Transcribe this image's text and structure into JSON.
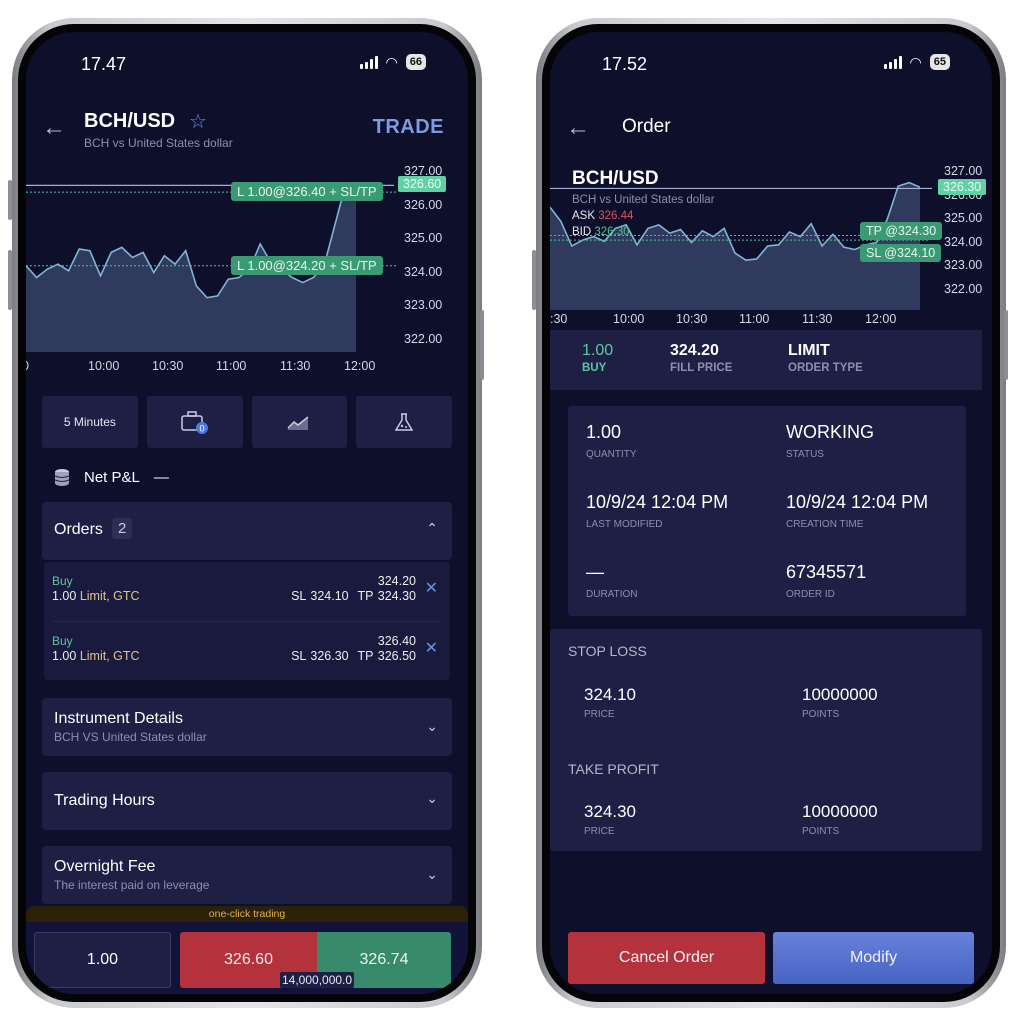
{
  "left": {
    "status": {
      "time": "17.47",
      "battery": "66"
    },
    "header": {
      "title": "BCH/USD",
      "subtitle": "BCH vs United States dollar",
      "trade_label": "TRADE"
    },
    "chart": {
      "y_ticks": [
        "327.00",
        "326.00",
        "325.00",
        "324.00",
        "323.00",
        "322.00"
      ],
      "x_ticks": [
        "0",
        "10:00",
        "10:30",
        "11:00",
        "11:30",
        "12:00"
      ],
      "current_price": "326.60",
      "order_lines": [
        {
          "label": "L 1.00@326.40 + SL/TP",
          "price": 326.4
        },
        {
          "label": "L 1.00@324.20 + SL/TP",
          "price": 324.2
        }
      ]
    },
    "tools": {
      "timeframe": "5 Minutes",
      "portfolio_badge": "0"
    },
    "net_pnl": {
      "label": "Net P&L",
      "value": "—"
    },
    "orders": {
      "title": "Orders",
      "count": "2",
      "items": [
        {
          "side": "Buy",
          "qty": "1.00",
          "type": "Limit, GTC",
          "price": "324.20",
          "sl": "SL 324.10",
          "tp": "TP 324.30"
        },
        {
          "side": "Buy",
          "qty": "1.00",
          "type": "Limit, GTC",
          "price": "326.40",
          "sl": "SL 326.30",
          "tp": "TP 326.50"
        }
      ]
    },
    "sections": [
      {
        "title": "Instrument Details",
        "subtitle": "BCH VS United States dollar"
      },
      {
        "title": "Trading Hours",
        "subtitle": ""
      },
      {
        "title": "Overnight Fee",
        "subtitle": "The interest paid on leverage"
      }
    ],
    "one_click": "one-click trading",
    "trade_bar": {
      "quantity": "1.00",
      "sell_price": "326.60",
      "buy_price": "326.74",
      "volume": "14,000,000.0"
    }
  },
  "right": {
    "status": {
      "time": "17.52",
      "battery": "65"
    },
    "header": {
      "title": "Order"
    },
    "chart": {
      "symbol": "BCH/USD",
      "subtitle": "BCH vs United States dollar",
      "ask_label": "ASK",
      "ask": "326.44",
      "bid_label": "BID",
      "bid": "326.30",
      "y_ticks": [
        "327.00",
        "326.00",
        "325.00",
        "324.00",
        "323.00",
        "322.00"
      ],
      "x_ticks": ":30",
      "x_ticks_list": [
        ":30",
        "10:00",
        "10:30",
        "11:00",
        "11:30",
        "12:00"
      ],
      "current_price": "326.30",
      "tp_label": "TP @324.30",
      "sl_label": "SL @324.10"
    },
    "summary": [
      {
        "value": "1.00",
        "label": "BUY"
      },
      {
        "value": "324.20",
        "label": "FILL PRICE"
      },
      {
        "value": "LIMIT",
        "label": "ORDER TYPE"
      }
    ],
    "details": [
      {
        "value": "1.00",
        "label": "QUANTITY"
      },
      {
        "value": "WORKING",
        "label": "STATUS"
      },
      {
        "value": "10/9/24 12:04 PM",
        "label": "LAST MODIFIED"
      },
      {
        "value": "10/9/24 12:04 PM",
        "label": "CREATION TIME"
      },
      {
        "value": "—",
        "label": "DURATION"
      },
      {
        "value": "67345571",
        "label": "ORDER ID"
      }
    ],
    "stop_loss": {
      "title": "STOP LOSS",
      "price": "324.10",
      "price_label": "PRICE",
      "points": "10000000",
      "points_label": "POINTS"
    },
    "take_profit": {
      "title": "TAKE PROFIT",
      "price": "324.30",
      "price_label": "PRICE",
      "points": "10000000",
      "points_label": "POINTS"
    },
    "buttons": {
      "cancel": "Cancel Order",
      "modify": "Modify"
    }
  },
  "series": {
    "left_prices": [
      324.2,
      323.85,
      324.1,
      324.25,
      324.05,
      324.7,
      324.65,
      323.9,
      324.6,
      324.75,
      324.45,
      324.6,
      324.0,
      324.5,
      324.25,
      324.65,
      323.6,
      323.25,
      323.3,
      323.8,
      323.85,
      324.1,
      324.85,
      324.3,
      324.1,
      323.85,
      323.7,
      323.85,
      324.2,
      325.4,
      326.6,
      326.6
    ],
    "right_prices": [
      325.5,
      324.9,
      323.85,
      324.1,
      324.25,
      324.05,
      324.6,
      324.75,
      323.9,
      324.6,
      324.75,
      324.4,
      324.55,
      324.0,
      324.5,
      324.25,
      324.6,
      323.55,
      323.25,
      323.3,
      323.85,
      323.9,
      324.45,
      324.25,
      324.8,
      323.85,
      324.35,
      323.8,
      323.7,
      323.9,
      324.0,
      325.0,
      326.4,
      326.55,
      326.35
    ]
  },
  "colors": {
    "accent": "#7f9be0",
    "buy": "#378a6c",
    "sell": "#b3323c",
    "tag": "#3a9a73",
    "background": "#0e0f2b"
  }
}
